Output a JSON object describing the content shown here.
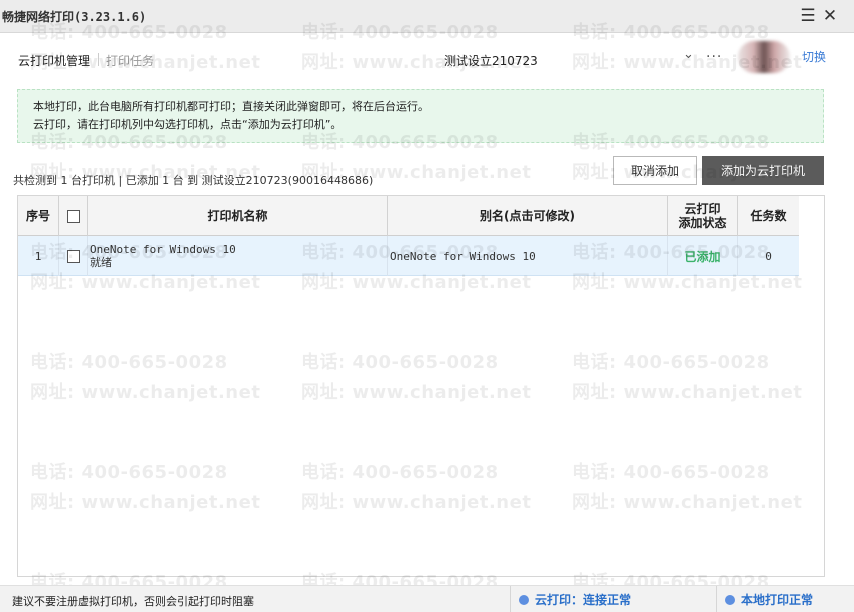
{
  "window": {
    "title": "畅捷网络打印(3.23.1.6)"
  },
  "header": {
    "tabs": [
      {
        "label": "云打印机管理"
      },
      {
        "label": "打印任务"
      }
    ],
    "account_name": "测试设立210723",
    "chevron": "⌄",
    "more": "···",
    "switch_label": "切换"
  },
  "banner": {
    "line1": "本地打印，此台电脑所有打印机都可打印；直接关闭此弹窗即可，将在后台运行。",
    "line2": "云打印，请在打印机列中勾选打印机，点击“添加为云打印机”。"
  },
  "summary": "共检测到 1 台打印机 | 已添加 1 台 到 测试设立210723(90016448686)",
  "buttons": {
    "cancel": "取消添加",
    "add": "添加为云打印机"
  },
  "table": {
    "headers": {
      "index": "序号",
      "name": "打印机名称",
      "alias": "别名(点击可修改)",
      "status_line1": "云打印",
      "status_line2": "添加状态",
      "tasks": "任务数"
    },
    "rows": [
      {
        "index": "1",
        "name": "OneNote for Windows 10",
        "state": "就绪",
        "alias": "OneNote for Windows 10",
        "status": "已添加",
        "tasks": "0"
      }
    ]
  },
  "statusbar": {
    "hint": "建议不要注册虚拟打印机，否则会引起打印时阻塞",
    "cloud": "云打印：连接正常",
    "local": "本地打印正常"
  },
  "watermark": {
    "phone": "电话: 400-665-0028",
    "site": "网址: www.chanjet.net"
  },
  "colors": {
    "accent": "#3a7bd5",
    "added": "#3cb36b",
    "banner_bg": "#e8f7ec",
    "primary_button": "#5b5b5b",
    "row_selected": "#e7f3fd"
  },
  "icons": {
    "menu": "menu-icon",
    "close": "close-icon"
  }
}
